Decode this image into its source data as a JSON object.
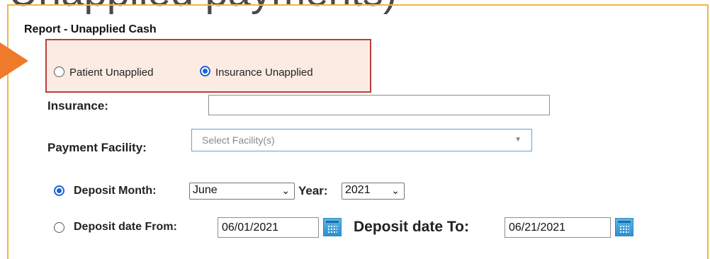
{
  "banner": {
    "text": "Unapplied payments)"
  },
  "report": {
    "title": "Report - Unapplied Cash"
  },
  "type_options": [
    {
      "label": "Patient Unapplied",
      "checked": false
    },
    {
      "label": "Insurance Unapplied",
      "checked": true
    }
  ],
  "insurance": {
    "label": "Insurance:",
    "value": ""
  },
  "payment_facility": {
    "label": "Payment Facility:",
    "placeholder": "Select Facility(s)"
  },
  "deposit_month": {
    "checked": true,
    "label": "Deposit Month:",
    "month": "June",
    "year_label": "Year:",
    "year": "2021"
  },
  "deposit_date": {
    "checked": false,
    "from_label": "Deposit date From:",
    "from_value": "06/01/2021",
    "to_label": "Deposit date To:",
    "to_value": "06/21/2021"
  },
  "colors": {
    "accent": "#1a63d6",
    "frame": "#f2b544",
    "highlight_border": "#b6403a",
    "arrow": "#ef7a2a"
  }
}
